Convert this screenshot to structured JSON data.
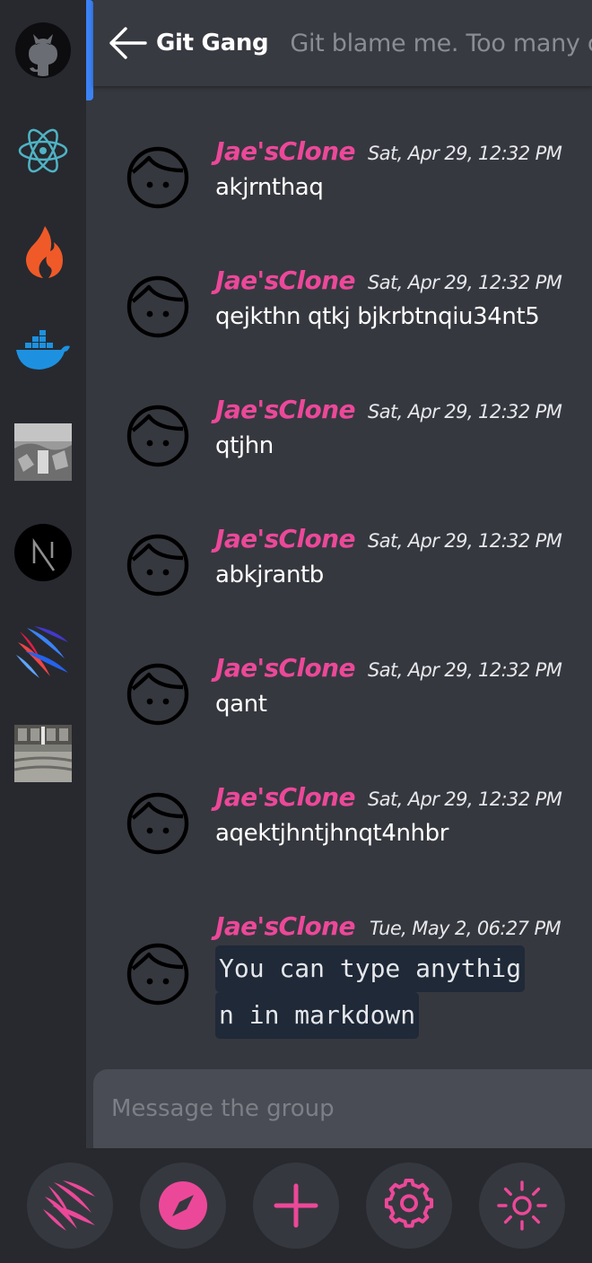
{
  "header": {
    "group_name": "Git Gang",
    "topic": "Git blame me. Too many commits"
  },
  "servers": [
    {
      "name": "github-icon"
    },
    {
      "name": "electron-icon"
    },
    {
      "name": "codeigniter-icon"
    },
    {
      "name": "docker-icon"
    },
    {
      "name": "photo-server-1"
    },
    {
      "name": "nextjs-icon"
    },
    {
      "name": "feather-logo-server"
    },
    {
      "name": "photo-server-2"
    }
  ],
  "messages": [
    {
      "author": "Jae'sClone",
      "timestamp": "Sat, Apr 29, 12:32 PM",
      "text": "akjrnthaq"
    },
    {
      "author": "Jae'sClone",
      "timestamp": "Sat, Apr 29, 12:32 PM",
      "text": "qejkthn qtkj bjkrbtnqiu34nt5"
    },
    {
      "author": "Jae'sClone",
      "timestamp": "Sat, Apr 29, 12:32 PM",
      "text": "qtjhn"
    },
    {
      "author": "Jae'sClone",
      "timestamp": "Sat, Apr 29, 12:32 PM",
      "text": "abkjrantb"
    },
    {
      "author": "Jae'sClone",
      "timestamp": "Sat, Apr 29, 12:32 PM",
      "text": "qant"
    },
    {
      "author": "Jae'sClone",
      "timestamp": "Sat, Apr 29, 12:32 PM",
      "text": "aqektjhntjhnqt4nhbr"
    },
    {
      "author": "Jae'sClone",
      "timestamp": "Tue, May 2, 06:27 PM",
      "code_lines": [
        "You can type anythig",
        "n in markdown"
      ]
    }
  ],
  "composer": {
    "placeholder": "Message the group"
  },
  "bottom_nav": [
    {
      "name": "logo-button"
    },
    {
      "name": "explore-button"
    },
    {
      "name": "add-server-button"
    },
    {
      "name": "settings-button"
    },
    {
      "name": "theme-toggle-button"
    }
  ],
  "colors": {
    "accent": "#ec4899",
    "active_indicator": "#3b82f6",
    "background": "#36383f",
    "rail": "#27292f"
  }
}
